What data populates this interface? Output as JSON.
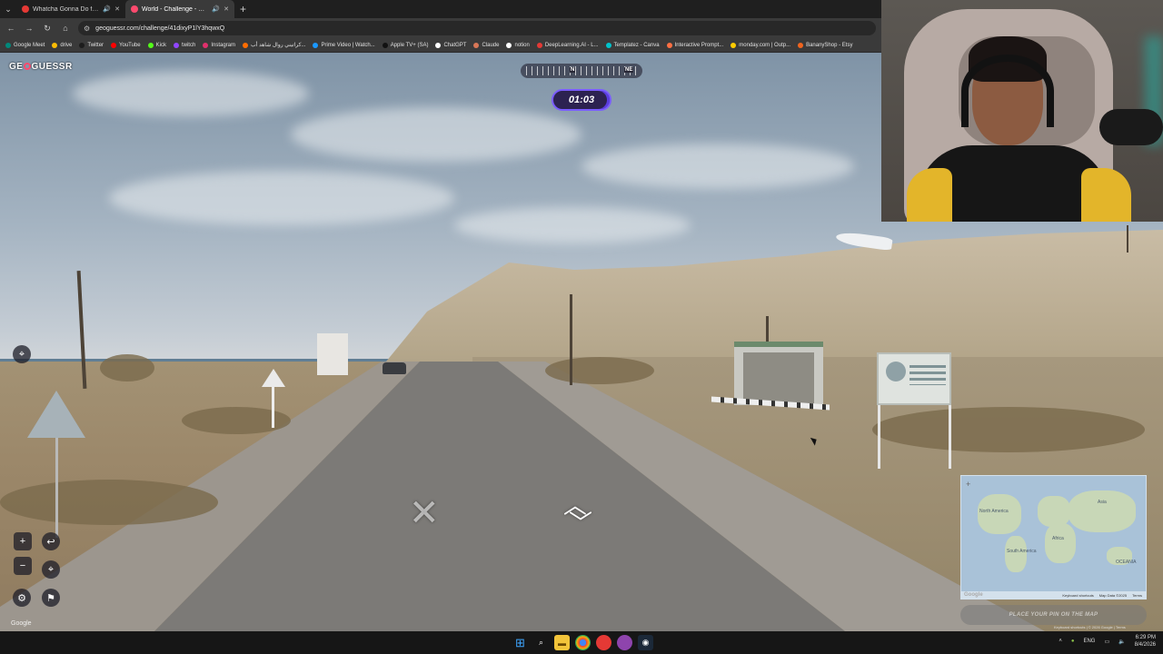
{
  "browser": {
    "tabs": [
      {
        "title": "Whatcha Gonna Do for Me",
        "favicon_color": "#e53935",
        "active": false
      },
      {
        "title": "World - Challenge - GeoGu",
        "favicon_color": "#ff4a6e",
        "active": true
      }
    ],
    "url": "geoguessr.com/challenge/41dixyP1lY3hqwxQ",
    "bookmarks": [
      {
        "label": "Google Meet",
        "color": "#00897b"
      },
      {
        "label": "drive",
        "color": "#fbbc04"
      },
      {
        "label": "Twitter",
        "color": "#1d1d1d"
      },
      {
        "label": "YouTube",
        "color": "#ff0000"
      },
      {
        "label": "Kick",
        "color": "#53fc18"
      },
      {
        "label": "twitch",
        "color": "#9146ff"
      },
      {
        "label": "Instagram",
        "color": "#e1306c"
      },
      {
        "label": "كراتيني روال شاهد أب...",
        "color": "#ff6d00"
      },
      {
        "label": "Prime Video | Watch...",
        "color": "#1a98ff"
      },
      {
        "label": "Apple TV+ (SA)",
        "color": "#111111"
      },
      {
        "label": "ChatGPT",
        "color": "#ffffff"
      },
      {
        "label": "Claude",
        "color": "#d97757"
      },
      {
        "label": "notion",
        "color": "#ffffff"
      },
      {
        "label": "DeepLearning.AI - L...",
        "color": "#e53935"
      },
      {
        "label": "Templatez - Canva",
        "color": "#00c4cc"
      },
      {
        "label": "Interactive Prompt...",
        "color": "#ff7043"
      },
      {
        "label": "monday.com | Outp...",
        "color": "#ffcc00"
      },
      {
        "label": "BananyShop - Etsy",
        "color": "#f1641e"
      }
    ]
  },
  "game": {
    "logo": "GEOGUESSR",
    "timer": "01:03",
    "compass": {
      "north": "N",
      "northeast": "NE"
    },
    "place_pin_label": "PLACE YOUR PIN ON THE MAP",
    "google_watermark": "Google",
    "map_google_logo": "Google",
    "map_footer": {
      "shortcuts": "Keyboard shortcuts",
      "data": "Map Data ©2025",
      "terms": "Terms"
    },
    "attribution": "Keyboard shortcuts | © 2026 Google | Terms",
    "map_labels": [
      "North America",
      "South America",
      "Asia",
      "Africa",
      "OCEANIA"
    ]
  },
  "taskbar": {
    "language": "ENG",
    "time": "6:29 PM",
    "date": "8/4/2026"
  }
}
